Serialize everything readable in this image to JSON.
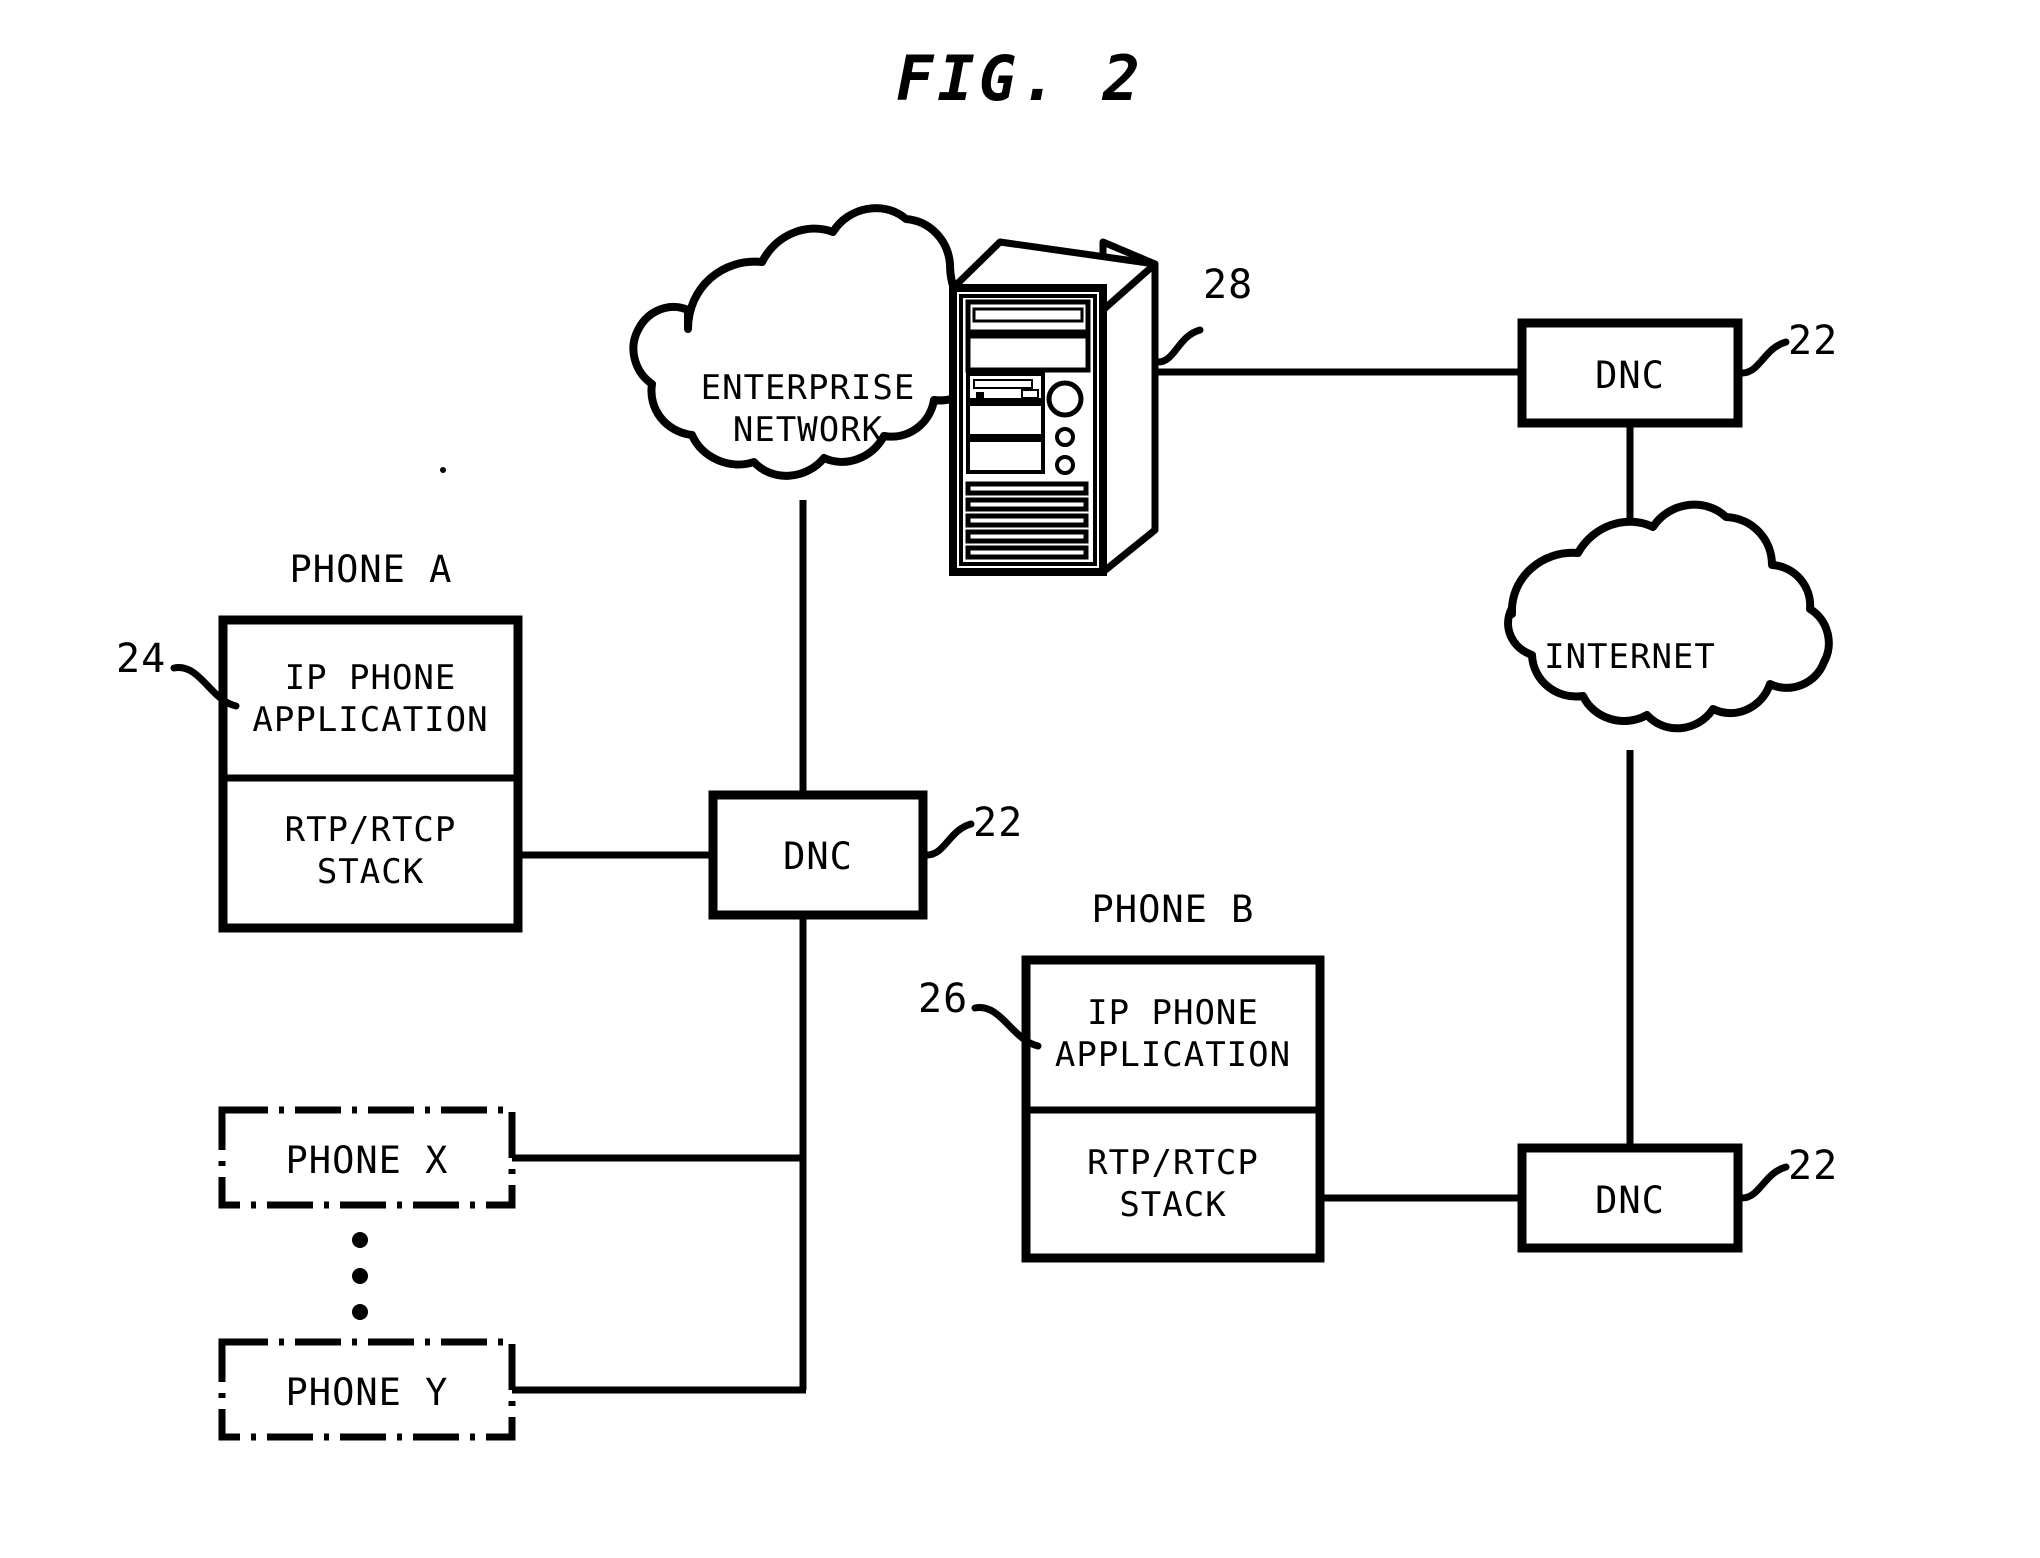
{
  "figure": {
    "title": "FIG. 2",
    "domain": "patent-network-diagram"
  },
  "clouds": [
    {
      "id": "enterprise",
      "label_line1": "ENTERPRISE",
      "label_line2": "NETWORK"
    },
    {
      "id": "internet",
      "label_line1": "INTERNET",
      "label_line2": ""
    }
  ],
  "server": {
    "name": "computer-tower",
    "reference": "28"
  },
  "phone_a": {
    "title": "PHONE A",
    "reference": "24",
    "upper_line1": "IP PHONE",
    "upper_line2": "APPLICATION",
    "lower_line1": "RTP/RTCP",
    "lower_line2": "STACK"
  },
  "phone_b": {
    "title": "PHONE B",
    "reference": "26",
    "upper_line1": "IP PHONE",
    "upper_line2": "APPLICATION",
    "lower_line1": "RTP/RTCP",
    "lower_line2": "STACK"
  },
  "phone_x": {
    "label": "PHONE X"
  },
  "phone_y": {
    "label": "PHONE Y"
  },
  "ellipsis": {
    "dots": 3
  },
  "dnc_nodes": [
    {
      "id": "dnc-top-right",
      "label": "DNC",
      "reference": "22"
    },
    {
      "id": "dnc-center",
      "label": "DNC",
      "reference": "22"
    },
    {
      "id": "dnc-bottom-right",
      "label": "DNC",
      "reference": "22"
    }
  ],
  "colors": {
    "ink": "#000000",
    "paper": "#ffffff"
  }
}
